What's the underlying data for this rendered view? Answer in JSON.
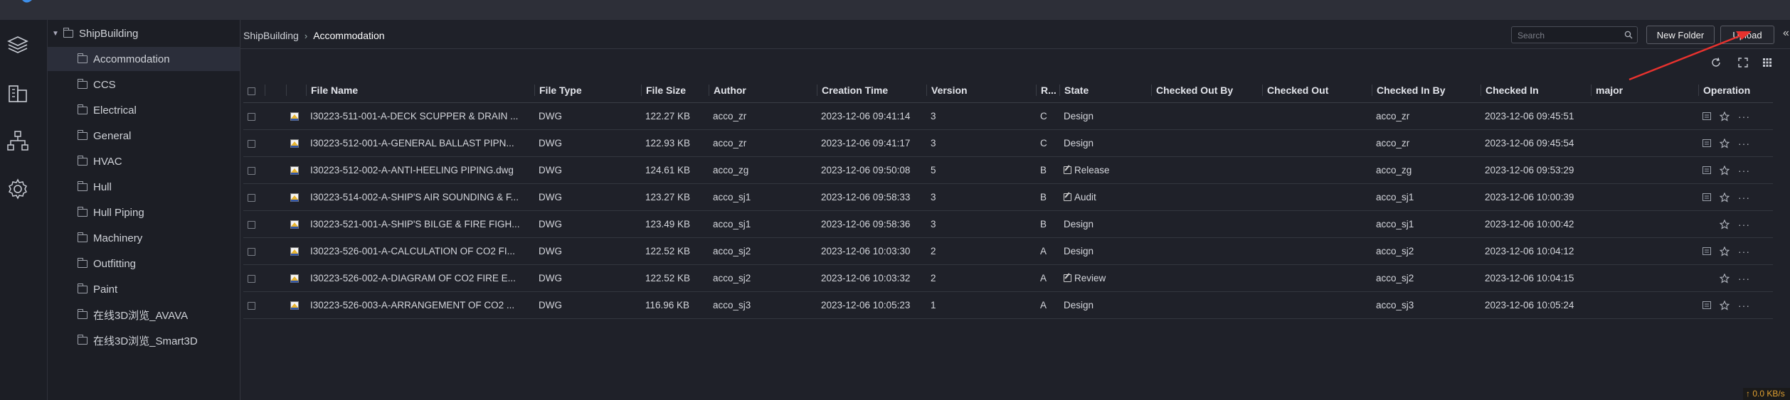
{
  "breadcrumb": [
    "ShipBuilding",
    "Accommodation"
  ],
  "tree": {
    "root": "ShipBuilding",
    "selected": "Accommodation",
    "children": [
      "Accommodation",
      "CCS",
      "Electrical",
      "General",
      "HVAC",
      "Hull",
      "Hull Piping",
      "Machinery",
      "Outfitting",
      "Paint",
      "在线3D浏览_AVAVA",
      "在线3D浏览_Smart3D"
    ]
  },
  "toolbar": {
    "search_placeholder": "Search",
    "new_folder_label": "New Folder",
    "upload_label": "Upload"
  },
  "table": {
    "columns": [
      "File Name",
      "File Type",
      "File Size",
      "Author",
      "Creation Time",
      "Version",
      "R...",
      "State",
      "Checked Out By",
      "Checked Out",
      "Checked In By",
      "Checked In",
      "major",
      "Operation"
    ],
    "rows": [
      {
        "name": "I30223-511-001-A-DECK SCUPPER & DRAIN ...",
        "type": "DWG",
        "size": "122.27 KB",
        "author": "acco_zr",
        "created": "2023-12-06 09:41:14",
        "version": "3",
        "rev": "C",
        "state": "Design",
        "state_icon": false,
        "checked_out_by": "",
        "checked_out": "",
        "checked_in_by": "acco_zr",
        "checked_in": "2023-12-06 09:45:51",
        "major": "",
        "has_comment": true
      },
      {
        "name": "I30223-512-001-A-GENERAL BALLAST PIPN...",
        "type": "DWG",
        "size": "122.93 KB",
        "author": "acco_zr",
        "created": "2023-12-06 09:41:17",
        "version": "3",
        "rev": "C",
        "state": "Design",
        "state_icon": false,
        "checked_out_by": "",
        "checked_out": "",
        "checked_in_by": "acco_zr",
        "checked_in": "2023-12-06 09:45:54",
        "major": "",
        "has_comment": true
      },
      {
        "name": "I30223-512-002-A-ANTI-HEELING PIPING.dwg",
        "type": "DWG",
        "size": "124.61 KB",
        "author": "acco_zg",
        "created": "2023-12-06 09:50:08",
        "version": "5",
        "rev": "B",
        "state": "Release",
        "state_icon": true,
        "checked_out_by": "",
        "checked_out": "",
        "checked_in_by": "acco_zg",
        "checked_in": "2023-12-06 09:53:29",
        "major": "",
        "has_comment": true
      },
      {
        "name": "I30223-514-002-A-SHIP'S AIR SOUNDING & F...",
        "type": "DWG",
        "size": "123.27 KB",
        "author": "acco_sj1",
        "created": "2023-12-06 09:58:33",
        "version": "3",
        "rev": "B",
        "state": "Audit",
        "state_icon": true,
        "checked_out_by": "",
        "checked_out": "",
        "checked_in_by": "acco_sj1",
        "checked_in": "2023-12-06 10:00:39",
        "major": "",
        "has_comment": true
      },
      {
        "name": "I30223-521-001-A-SHIP'S BILGE & FIRE FIGH...",
        "type": "DWG",
        "size": "123.49 KB",
        "author": "acco_sj1",
        "created": "2023-12-06 09:58:36",
        "version": "3",
        "rev": "B",
        "state": "Design",
        "state_icon": false,
        "checked_out_by": "",
        "checked_out": "",
        "checked_in_by": "acco_sj1",
        "checked_in": "2023-12-06 10:00:42",
        "major": "",
        "has_comment": false
      },
      {
        "name": "I30223-526-001-A-CALCULATION OF CO2 FI...",
        "type": "DWG",
        "size": "122.52 KB",
        "author": "acco_sj2",
        "created": "2023-12-06 10:03:30",
        "version": "2",
        "rev": "A",
        "state": "Design",
        "state_icon": false,
        "checked_out_by": "",
        "checked_out": "",
        "checked_in_by": "acco_sj2",
        "checked_in": "2023-12-06 10:04:12",
        "major": "",
        "has_comment": true
      },
      {
        "name": "I30223-526-002-A-DIAGRAM OF CO2 FIRE E...",
        "type": "DWG",
        "size": "122.52 KB",
        "author": "acco_sj2",
        "created": "2023-12-06 10:03:32",
        "version": "2",
        "rev": "A",
        "state": "Review",
        "state_icon": true,
        "checked_out_by": "",
        "checked_out": "",
        "checked_in_by": "acco_sj2",
        "checked_in": "2023-12-06 10:04:15",
        "major": "",
        "has_comment": false
      },
      {
        "name": "I30223-526-003-A-ARRANGEMENT OF CO2 ...",
        "type": "DWG",
        "size": "116.96 KB",
        "author": "acco_sj3",
        "created": "2023-12-06 10:05:23",
        "version": "1",
        "rev": "A",
        "state": "Design",
        "state_icon": false,
        "checked_out_by": "",
        "checked_out": "",
        "checked_in_by": "acco_sj3",
        "checked_in": "2023-12-06 10:05:24",
        "major": "",
        "has_comment": true
      }
    ]
  },
  "status": {
    "speed": "↑ 0.0 KB/s"
  },
  "colors": {
    "annotation_arrow": "#e8322e",
    "accent_text": "#e0a030"
  }
}
